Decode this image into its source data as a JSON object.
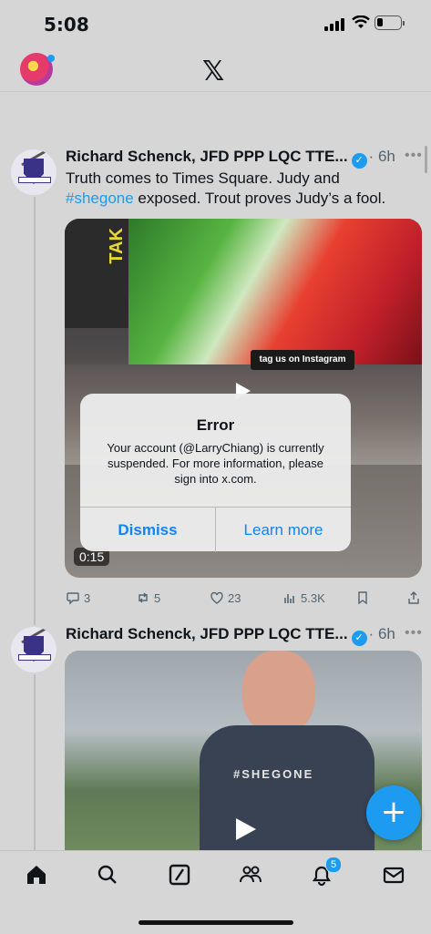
{
  "status_bar": {
    "time": "5:08"
  },
  "header": {
    "logo": "𝕏"
  },
  "posts": [
    {
      "author": "Richard Schenck, JFD PPP LQC TTE...",
      "time": "6h",
      "text_before": "Truth comes to Times Square. Judy and",
      "hashtag": "#shegone",
      "text_after": " exposed. Trout proves Judy’s a fool.",
      "media": {
        "billboard_text": "TAK",
        "instagram_banner": "tag us on Instagram",
        "duration": "0:15"
      },
      "replies": "3",
      "reposts": "5",
      "likes": "23",
      "views": "5.3K"
    },
    {
      "author": "Richard Schenck, JFD PPP LQC TTE...",
      "time": "6h",
      "media": {
        "shirt_text": "#SHEGONE"
      }
    }
  ],
  "dialog": {
    "title": "Error",
    "message": "Your account (@LarryChiang) is currently suspended. For more information, please sign into x.com.",
    "dismiss": "Dismiss",
    "learn_more": "Learn more"
  },
  "fab": {
    "label": "+"
  },
  "tabbar": {
    "notifications_badge": "5"
  },
  "colors": {
    "accent": "#1d9bf0",
    "background": "#d6d6d6"
  }
}
